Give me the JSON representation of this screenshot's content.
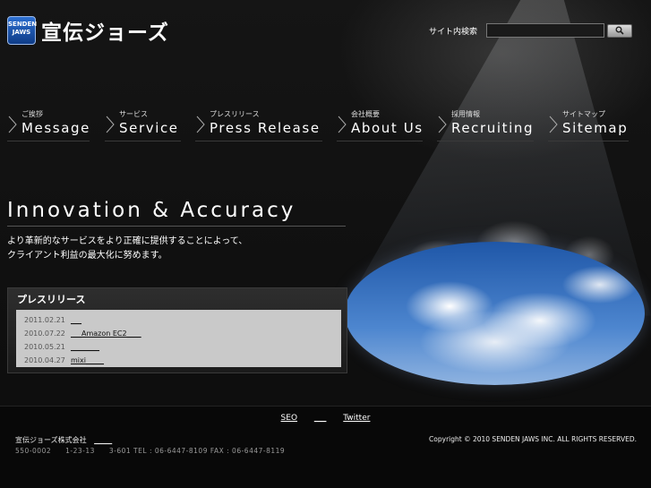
{
  "header": {
    "logo_mark_line1": "SENDEN",
    "logo_mark_line2": "JAWS",
    "logo_text": "宣伝ジョーズ",
    "search_label": "サイト内検索",
    "search_value": "",
    "search_button_icon": "search-icon"
  },
  "nav": [
    {
      "jp": "ご挨拶",
      "en": "Message"
    },
    {
      "jp": "サービス",
      "en": "Service"
    },
    {
      "jp": "プレスリリース",
      "en": "Press Release"
    },
    {
      "jp": "会社概要",
      "en": "About Us"
    },
    {
      "jp": "採用情報",
      "en": "Recruiting"
    },
    {
      "jp": "サイトマップ",
      "en": "Sitemap"
    }
  ],
  "hero": {
    "tagline": "Innovation & Accuracy",
    "lead_line1": "より革新的なサービスをより正確に提供することによって、",
    "lead_line2": "クライアント利益の最大化に努めます。"
  },
  "press": {
    "title": "プレスリリース",
    "items": [
      {
        "date": "2011.02.21",
        "text": "___"
      },
      {
        "date": "2010.07.22",
        "text": "___Amazon EC2____"
      },
      {
        "date": "2010.05.21",
        "text": "________"
      },
      {
        "date": "2010.04.27",
        "text": "mixi_____"
      }
    ]
  },
  "footer": {
    "links": [
      "SEO",
      "___",
      "Twitter"
    ],
    "company": "宣伝ジョーズ株式会社",
    "company_link": "_____",
    "address": "550-0002　　1-23-13　　3-601 TEL : 06-6447-8109 FAX : 06-6447-8119",
    "copyright": "Copyright © 2010 SENDEN JAWS INC. ALL RIGHTS RESERVED."
  }
}
